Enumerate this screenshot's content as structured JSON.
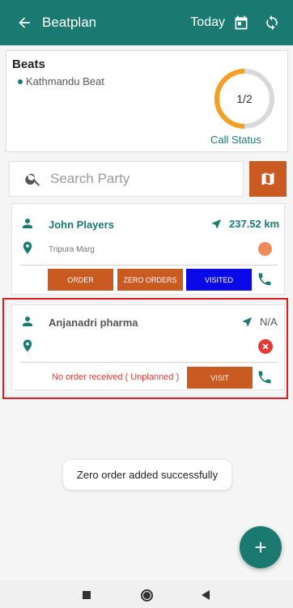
{
  "appbar": {
    "title": "Beatplan",
    "date_label": "Today"
  },
  "beats": {
    "heading": "Beats",
    "beat_name": "Kathmandu Beat",
    "progress_text": "1/2",
    "progress_fraction": 0.5,
    "status_label": "Call Status"
  },
  "search": {
    "placeholder": "Search Party"
  },
  "parties": [
    {
      "name": "John Players",
      "distance": "237.52 km",
      "address": "Tripura Marg",
      "buttons": [
        "ORDER",
        "ZERO ORDERS",
        "VISITED"
      ]
    },
    {
      "name": "Anjanadri pharma",
      "distance": "N/A",
      "status_text": "No order received ( Unplanned )",
      "button": "VISIT"
    }
  ],
  "toast": "Zero order added successfully",
  "colors": {
    "primary": "#1a7a72",
    "accent": "#c95a22",
    "visited": "#0a0ae8",
    "error": "#e53935",
    "ring_track": "#d9d9d9",
    "ring_fill": "#f2a125"
  }
}
